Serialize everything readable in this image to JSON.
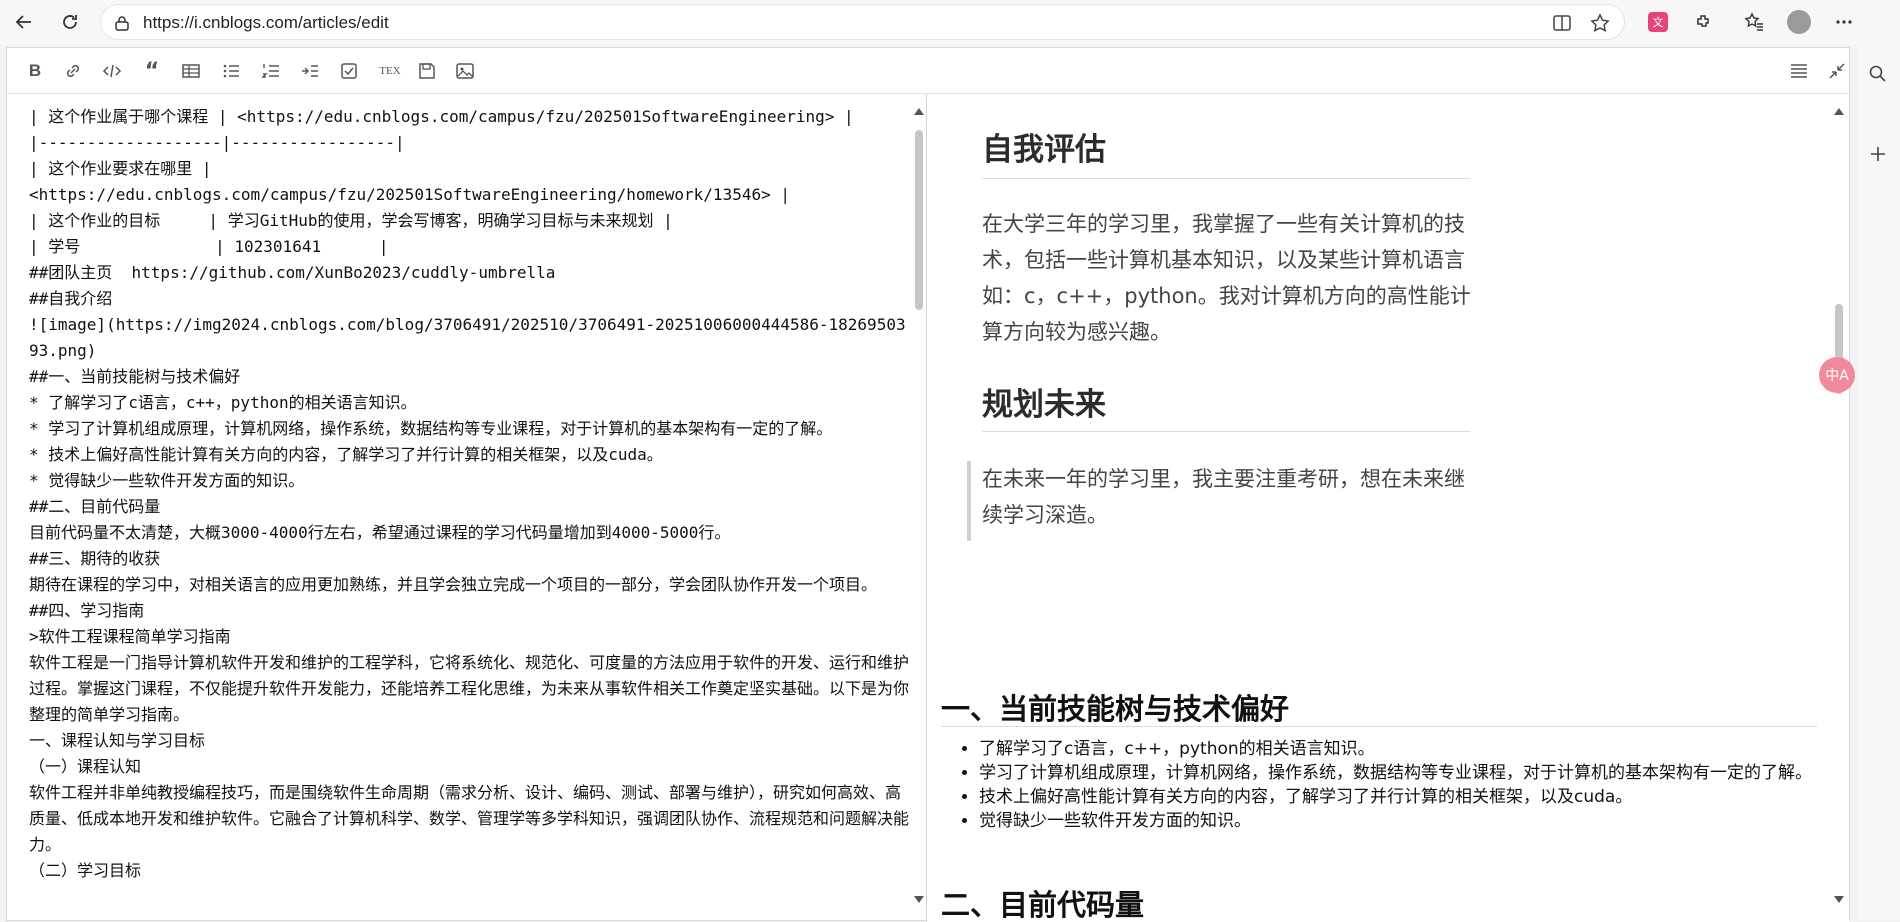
{
  "browser": {
    "url": "https://i.cnblogs.com/articles/edit",
    "icons": [
      "back-icon",
      "refresh-icon",
      "site-info-icon",
      "split-screen-icon",
      "favorite-star-icon",
      "translate-ext-icon",
      "extensions-icon",
      "favorites-icon",
      "profile-avatar",
      "more-icon"
    ]
  },
  "toolbar": {
    "bold": "B",
    "tex": "TEX"
  },
  "source": {
    "lines": [
      "| 这个作业属于哪个课程 | <https://edu.cnblogs.com/campus/fzu/202501SoftwareEngineering> |",
      "|-------------------|-----------------|",
      "| 这个作业要求在哪里 |",
      "<https://edu.cnblogs.com/campus/fzu/202501SoftwareEngineering/homework/13546> |",
      "| 这个作业的目标     | 学习GitHub的使用，学会写博客，明确学习目标与未来规划 |",
      "| 学号              | 102301641      |",
      "##团队主页  https://github.com/XunBo2023/cuddly-umbrella",
      "##自我介绍",
      "![image](https://img2024.cnblogs.com/blog/3706491/202510/3706491-20251006000444586-1826950393.png)",
      "##一、当前技能树与技术偏好",
      "* 了解学习了c语言，c++，python的相关语言知识。",
      "* 学习了计算机组成原理，计算机网络，操作系统，数据结构等专业课程，对于计算机的基本架构有一定的了解。",
      "* 技术上偏好高性能计算有关方向的内容，了解学习了并行计算的相关框架，以及cuda。",
      "* 觉得缺少一些软件开发方面的知识。",
      "##二、目前代码量",
      "目前代码量不太清楚，大概3000-4000行左右，希望通过课程的学习代码量增加到4000-5000行。",
      "##三、期待的收获",
      "期待在课程的学习中，对相关语言的应用更加熟练，并且学会独立完成一个项目的一部分，学会团队协作开发一个项目。",
      "##四、学习指南",
      ">软件工程课程简单学习指南",
      "软件工程是一门指导计算机软件开发和维护的工程学科，它将系统化、规范化、可度量的方法应用于软件的开发、运行和维护过程。掌握这门课程，不仅能提升软件开发能力，还能培养工程化思维，为未来从事软件相关工作奠定坚实基础。以下是为你整理的简单学习指南。",
      "一、课程认知与学习目标",
      "（一）课程认知",
      "软件工程并非单纯教授编程技巧，而是围绕软件生命周期（需求分析、设计、编码、测试、部署与维护），研究如何高效、高质量、低成本地开发和维护软件。它融合了计算机科学、数学、管理学等多学科知识，强调团队协作、流程规范和问题解决能力。",
      "（二）学习目标"
    ]
  },
  "preview": {
    "h_self_eval": "自我评估",
    "p_self_eval": "在大学三年的学习里，我掌握了一些有关计算机的技术，包括一些计算机基本知识，以及某些计算机语言如：c，c++，python。我对计算机方向的高性能计算方向较为感兴趣。",
    "h_plan": "规划未来",
    "p_plan": "在未来一年的学习里，我主要注重考研，想在未来继续学习深造。",
    "h_skill": "一、当前技能树与技术偏好",
    "skills": [
      "了解学习了c语言，c++，python的相关语言知识。",
      "学习了计算机组成原理，计算机网络，操作系统，数据结构等专业课程，对于计算机的基本架构有一定的了解。",
      "技术上偏好高性能计算有关方向的内容，了解学习了并行计算的相关框架，以及cuda。",
      "觉得缺少一些软件开发方面的知识。"
    ],
    "h_code": "二、目前代码量",
    "p_code": "目前代码量不太清楚，大概3000-4000行左右，希望通过课程的学习代码量增加到4000-5000行。"
  },
  "fab": {
    "translate": "中A"
  }
}
